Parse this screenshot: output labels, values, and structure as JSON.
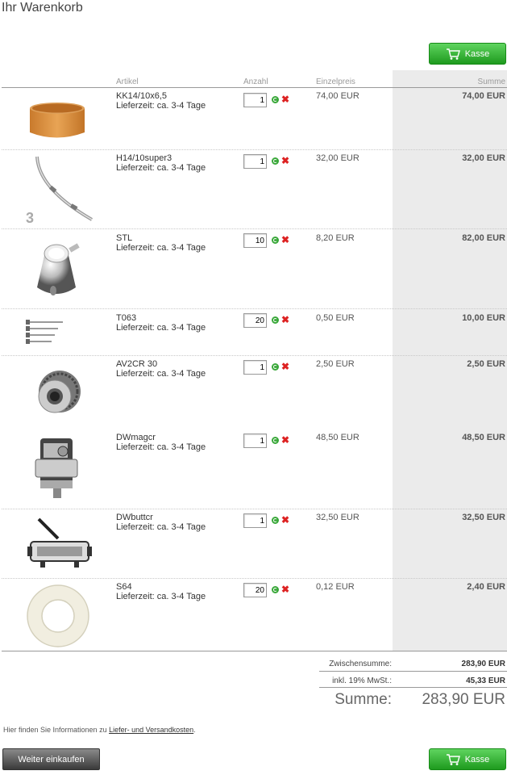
{
  "page": {
    "title": "Ihr Warenkorb"
  },
  "checkout_button": {
    "label": "Kasse"
  },
  "table": {
    "headers": {
      "article": "Artikel",
      "quantity": "Anzahl",
      "unit_price": "Einzelpreis",
      "sum": "Summe"
    },
    "rows": [
      {
        "name": "KK14/10x6,5",
        "lead_time": "Lieferzeit: ca. 3-4 Tage",
        "qty": "1",
        "unit_price": "74,00 EUR",
        "total": "74,00 EUR",
        "image": "wooden-ring"
      },
      {
        "name": "H14/10super3",
        "lead_time": "Lieferzeit: ca. 3-4 Tage",
        "qty": "1",
        "unit_price": "32,00 EUR",
        "total": "32,00 EUR",
        "image": "metal-hoop",
        "image_badge": "3"
      },
      {
        "name": "STL",
        "lead_time": "Lieferzeit: ca. 3-4 Tage",
        "qty": "10",
        "unit_price": "8,20 EUR",
        "total": "82,00 EUR",
        "image": "chrome-lug"
      },
      {
        "name": "T063",
        "lead_time": "Lieferzeit: ca. 3-4 Tage",
        "qty": "20",
        "unit_price": "0,50 EUR",
        "total": "10,00 EUR",
        "image": "tension-rods"
      },
      {
        "name": "AV2CR 30",
        "lead_time": "Lieferzeit: ca. 3-4 Tage",
        "qty": "1",
        "unit_price": "2,50 EUR",
        "total": "2,50 EUR",
        "image": "air-vent"
      },
      {
        "name": "DWmagcr",
        "lead_time": "Lieferzeit: ca. 3-4 Tage",
        "qty": "1",
        "unit_price": "48,50 EUR",
        "total": "48,50 EUR",
        "image": "snare-strainer"
      },
      {
        "name": "DWbuttcr",
        "lead_time": "Lieferzeit: ca. 3-4 Tage",
        "qty": "1",
        "unit_price": "32,50 EUR",
        "total": "32,50 EUR",
        "image": "butt-plate"
      },
      {
        "name": "S64",
        "lead_time": "Lieferzeit: ca. 3-4 Tage",
        "qty": "20",
        "unit_price": "0,12 EUR",
        "total": "2,40 EUR",
        "image": "white-washer"
      }
    ]
  },
  "totals": {
    "subtotal_label": "Zwischensumme:",
    "subtotal_value": "283,90 EUR",
    "vat_label": "inkl. 19% MwSt.:",
    "vat_value": "45,33 EUR",
    "grand_label": "Summe:",
    "grand_value": "283,90 EUR"
  },
  "info": {
    "text": "Hier finden Sie Informationen zu ",
    "link": "Liefer- und Versandkosten",
    "suffix": "."
  },
  "continue_button": {
    "label": "Weiter einkaufen"
  },
  "colors": {
    "accent_green": "#2aa52a",
    "delete_red": "#dd2222",
    "sum_column_bg": "#ebebeb"
  }
}
